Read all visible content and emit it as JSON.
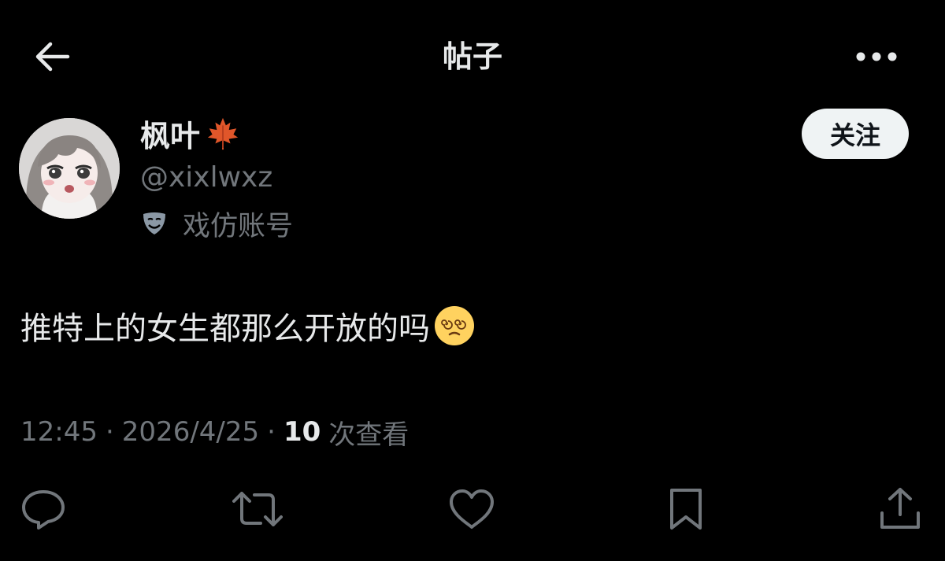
{
  "header": {
    "title": "帖子",
    "back_icon": "arrow-left-icon",
    "more_icon": "more-horizontal-icon"
  },
  "author": {
    "display_name": "枫叶",
    "name_emoji": "maple-leaf-icon",
    "handle": "@xixlwxz",
    "parody_label": "戏仿账号",
    "parody_icon": "theater-mask-icon",
    "follow_label": "关注"
  },
  "post": {
    "text": "推特上的女生都那么开放的吗",
    "emoji": "dizzy-face-icon"
  },
  "meta": {
    "time": "12:45",
    "separator": "·",
    "date": "2026/4/25",
    "views_count": "10",
    "views_label": "次查看"
  },
  "actions": [
    "reply-icon",
    "retweet-icon",
    "like-icon",
    "bookmark-icon",
    "share-icon"
  ],
  "colors": {
    "background": "#000000",
    "primary_text": "#e7e9ea",
    "secondary_text": "#71767b",
    "follow_button_bg": "#eff3f4",
    "follow_button_text": "#0f1419"
  }
}
